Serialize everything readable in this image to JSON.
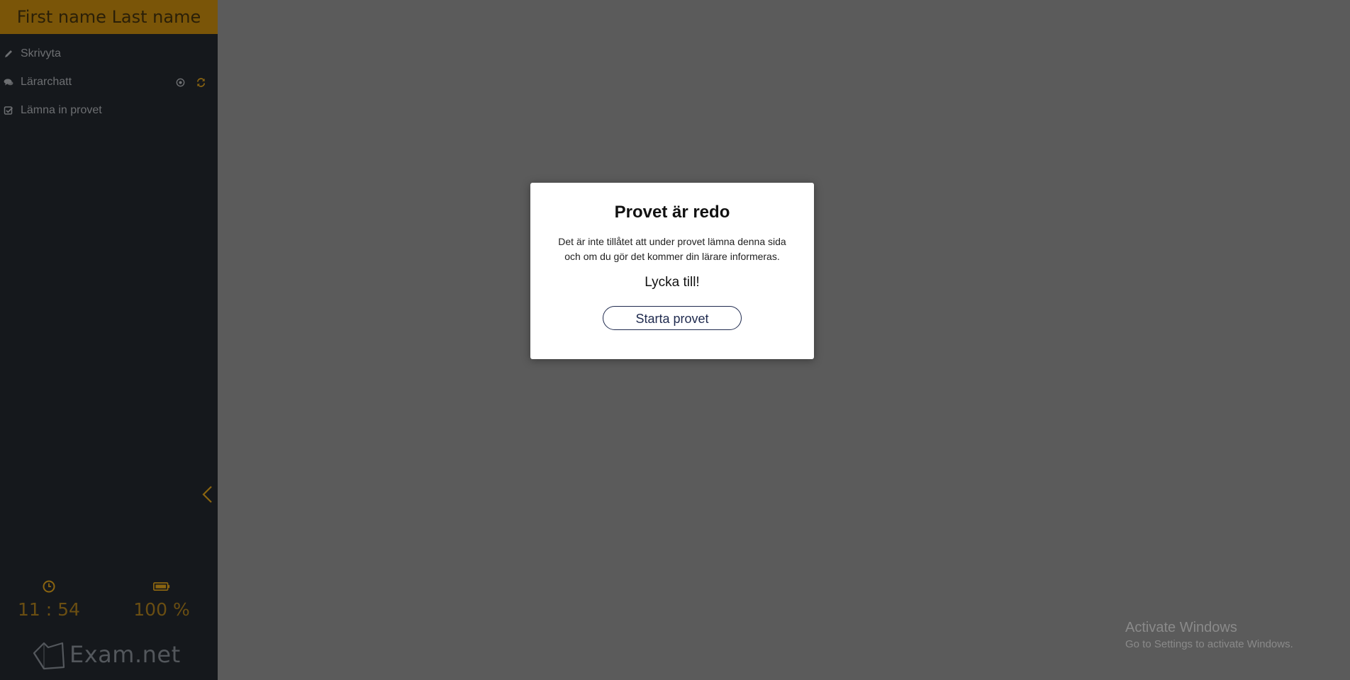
{
  "sidebar": {
    "user_name": "First name Last name",
    "items": [
      {
        "label": "Skrivyta",
        "icon": "pencil-icon"
      },
      {
        "label": "Lärarchatt",
        "icon": "chat-icon",
        "extras": [
          "target-icon",
          "refresh-icon"
        ]
      },
      {
        "label": "Lämna in provet",
        "icon": "checkbox-icon"
      }
    ],
    "collapse_icon": "chevron-left-icon",
    "clock": {
      "icon": "clock-icon",
      "value": "11 : 54"
    },
    "battery": {
      "icon": "battery-icon",
      "value": "100 %"
    },
    "logo_text": "Exam.net"
  },
  "modal": {
    "title": "Provet är redo",
    "body": "Det är inte tillåtet att under provet lämna denna sida och om du gör det kommer din lärare informeras.",
    "wish": "Lycka till!",
    "button_label": "Starta provet"
  },
  "watermark": {
    "title": "Activate Windows",
    "subtitle": "Go to Settings to activate Windows."
  },
  "colors": {
    "header_bg": "#7a5508",
    "sidebar_bg": "#15181c",
    "overlay_bg": "#5b5b5b",
    "accent": "#8a6410",
    "button_border": "#1f2a4e"
  }
}
